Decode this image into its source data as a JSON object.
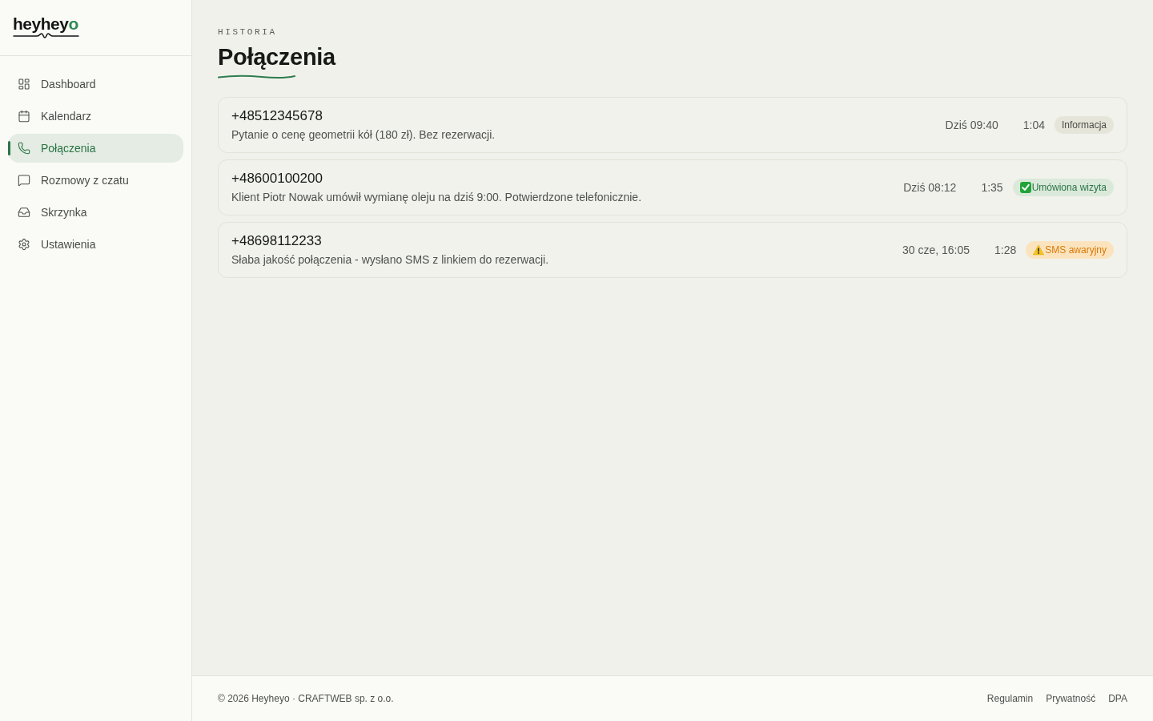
{
  "sidebar": {
    "logo": {
      "text": "heyhey",
      "accent": "o"
    },
    "items": [
      {
        "label": "Dashboard",
        "selected": false
      },
      {
        "label": "Kalendarz",
        "selected": false
      },
      {
        "label": "Połączenia",
        "selected": true
      },
      {
        "label": "Rozmowy z czatu",
        "selected": false
      },
      {
        "label": "Skrzynka",
        "selected": false
      },
      {
        "label": "Ustawienia",
        "selected": false
      }
    ]
  },
  "header": {
    "eyebrow": "HISTORIA",
    "title": "Połączenia"
  },
  "calls": [
    {
      "phone": "+48512345678",
      "summary": "Pytanie o cenę geometrii kół (180 zł). Bez rezerwacji.",
      "time": "Dziś 09:40",
      "duration": "1:04",
      "badge": {
        "kind": "info",
        "label": "Informacja"
      }
    },
    {
      "phone": "+48600100200",
      "summary": "Klient Piotr Nowak umówił wymianę oleju na dziś 9:00. Potwierdzone telefonicznie.",
      "time": "Dziś 08:12",
      "duration": "1:35",
      "badge": {
        "kind": "booked",
        "label": "Umówiona wizyta"
      }
    },
    {
      "phone": "+48698112233",
      "summary": "Słaba jakość połączenia - wysłano SMS z linkiem do rezerwacji.",
      "time": "30 cze, 16:05",
      "duration": "1:28",
      "badge": {
        "kind": "warning",
        "label": "SMS awaryjny"
      }
    }
  ],
  "footer": {
    "copyright": "© 2026 Heyheyo · CRAFTWEB sp. z o.o.",
    "links": [
      "Regulamin",
      "Prywatność",
      "DPA"
    ]
  }
}
